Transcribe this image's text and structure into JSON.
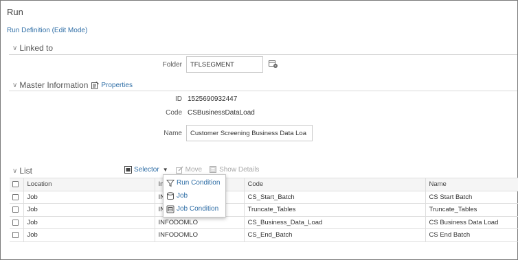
{
  "app": {
    "title": "Run",
    "subtitle": "Run Definition (Edit Mode)"
  },
  "sections": {
    "linked_to": "Linked to",
    "master_information": "Master Information",
    "properties_link": "Properties",
    "list": "List"
  },
  "fields": {
    "folder": {
      "label": "Folder",
      "value": "TFLSEGMENT"
    },
    "id": {
      "label": "ID",
      "value": "1525690932447"
    },
    "code": {
      "label": "Code",
      "value": "CSBusinessDataLoad"
    },
    "name": {
      "label": "Name",
      "value": "Customer Screening Business Data Loa"
    }
  },
  "toolbar": {
    "selector": "Selector",
    "move": "Move",
    "show_details": "Show Details"
  },
  "selector_menu": {
    "items": [
      "Run Condition",
      "Job",
      "Job Condition"
    ]
  },
  "table": {
    "headers": [
      "Location",
      "Info",
      "Code",
      "Name"
    ],
    "rows": [
      [
        "Job",
        "INFODOMLO",
        "CS_Start_Batch",
        "CS Start Batch"
      ],
      [
        "Job",
        "INFODOMLO",
        "Truncate_Tables",
        "Truncate_Tables"
      ],
      [
        "Job",
        "INFODOMLO",
        "CS_Business_Data_Load",
        "CS Business Data Load"
      ],
      [
        "Job",
        "INFODOMLO",
        "CS_End_Batch",
        "CS End Batch"
      ]
    ]
  },
  "colors": {
    "link": "#2f6ea6",
    "text": "#333333",
    "disabled": "#a8a8a8",
    "header_bg": "#f5f5f5"
  }
}
